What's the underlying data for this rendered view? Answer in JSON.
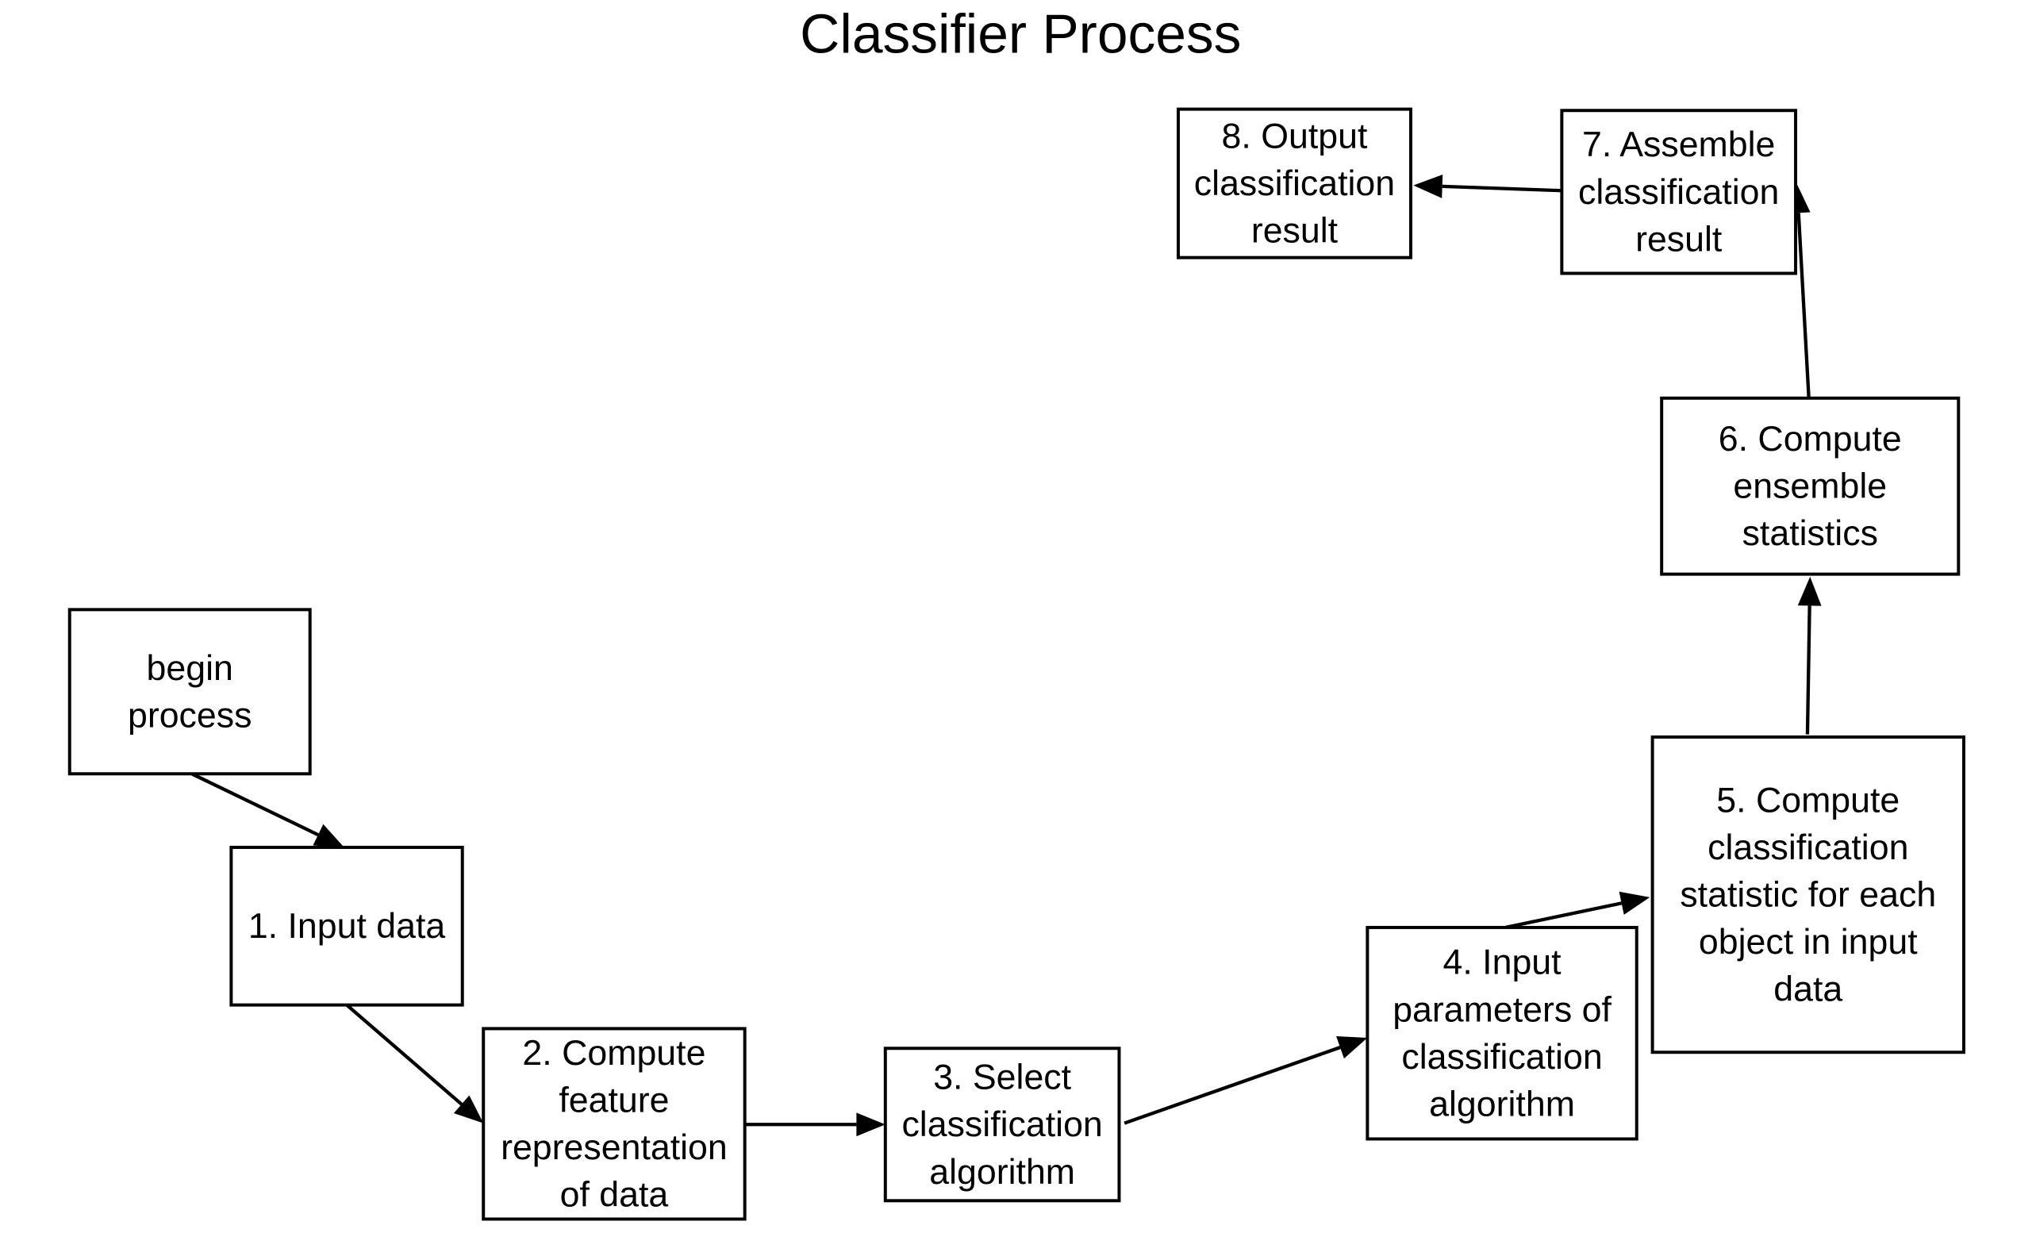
{
  "title": "Classifier Process",
  "colors": {
    "stroke": "#000000",
    "background": "#ffffff"
  },
  "nodes": [
    {
      "id": "begin",
      "lines": [
        "begin",
        "process"
      ]
    },
    {
      "id": "step1",
      "lines": [
        "1. Input data"
      ]
    },
    {
      "id": "step2",
      "lines": [
        "2. Compute",
        "feature",
        "representation",
        "of data"
      ]
    },
    {
      "id": "step3",
      "lines": [
        "3. Select",
        "classification",
        "algorithm"
      ]
    },
    {
      "id": "step4",
      "lines": [
        "4. Input",
        "parameters of",
        "classification",
        "algorithm"
      ]
    },
    {
      "id": "step5",
      "lines": [
        "5. Compute",
        "classification",
        "statistic for each",
        "object in input",
        "data"
      ]
    },
    {
      "id": "step6",
      "lines": [
        "6. Compute",
        "ensemble",
        "statistics"
      ]
    },
    {
      "id": "step7",
      "lines": [
        "7. Assemble",
        "classification",
        "result"
      ]
    },
    {
      "id": "step8",
      "lines": [
        "8. Output",
        "classification",
        "result"
      ]
    }
  ],
  "edges": [
    {
      "from": "begin",
      "to": "step1"
    },
    {
      "from": "step1",
      "to": "step2"
    },
    {
      "from": "step2",
      "to": "step3"
    },
    {
      "from": "step3",
      "to": "step4"
    },
    {
      "from": "step4",
      "to": "step5"
    },
    {
      "from": "step5",
      "to": "step6"
    },
    {
      "from": "step6",
      "to": "step7"
    },
    {
      "from": "step7",
      "to": "step8"
    }
  ]
}
